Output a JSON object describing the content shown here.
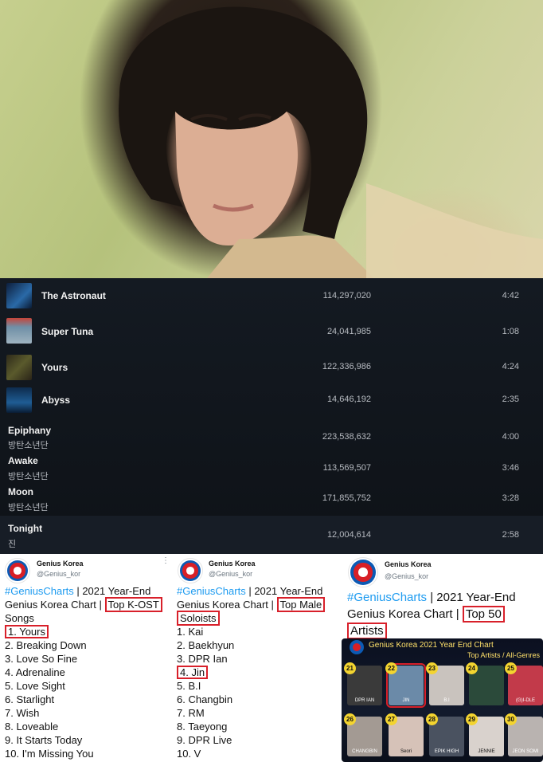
{
  "tracks": [
    {
      "title": "The Astronaut",
      "artist": "",
      "plays": "114,297,020",
      "duration": "4:42",
      "thumb": "#2a6aa8",
      "hasArt": true
    },
    {
      "title": "Super Tuna",
      "artist": "",
      "plays": "24,041,985",
      "duration": "1:08",
      "thumb": "#6f8fa6",
      "hasArt": true
    },
    {
      "title": "Yours",
      "artist": "",
      "plays": "122,336,986",
      "duration": "4:24",
      "thumb": "#4a4f2a",
      "hasArt": true
    },
    {
      "title": "Abyss",
      "artist": "",
      "plays": "14,646,192",
      "duration": "2:35",
      "thumb": "#1c4a7a",
      "hasArt": true
    },
    {
      "title": "Epiphany",
      "artist": "방탄소년단",
      "plays": "223,538,632",
      "duration": "4:00",
      "hasArt": false
    },
    {
      "title": "Awake",
      "artist": "방탄소년단",
      "plays": "113,569,507",
      "duration": "3:46",
      "hasArt": false
    },
    {
      "title": "Moon",
      "artist": "방탄소년단",
      "plays": "171,855,752",
      "duration": "3:28",
      "hasArt": false
    },
    {
      "title": "Tonight",
      "artist": "진",
      "plays": "12,004,614",
      "duration": "2:58",
      "hasArt": false
    }
  ],
  "tweets": [
    {
      "name": "Genius Korea",
      "handle": "@Genius_kor",
      "hashtag": "#GeniusCharts",
      "text_a": " | 2021 Year-End Genius Korea Chart | ",
      "boxed": "Top K-OST",
      "text_b": " Songs",
      "list": [
        "1. Yours",
        "2. Breaking Down",
        "3. Love So Fine",
        "4. Adrenaline",
        "5. Love Sight",
        "6. Starlight",
        "7. Wish",
        "8. Loveable",
        "9. It Starts Today",
        "10. I'm Missing You"
      ]
    },
    {
      "name": "Genius Korea",
      "handle": "@Genius_kor",
      "hashtag": "#GeniusCharts",
      "text_a": " | 2021 Year-End Genius Korea Chart | ",
      "boxed_a": "Top Male",
      "boxed_b": "Soloists",
      "list": [
        "1. Kai",
        "2. Baekhyun",
        "3. DPR Ian",
        "4. Jin",
        "5. B.I",
        "6. Changbin",
        "7. RM",
        "8. Taeyong",
        "9. DPR Live",
        "10. V"
      ]
    },
    {
      "name": "Genius Korea",
      "handle": "@Genius_kor",
      "hashtag": "#GeniusCharts",
      "text_a": " | 2021 Year-End Genius Korea Chart | ",
      "boxed_a": "Top 50",
      "boxed_b": "Artists",
      "chart_title": "Genius Korea 2021 Year End Chart",
      "chart_sub": "Top Artists / All-Genres",
      "artists": [
        {
          "rank": "21",
          "name": "DPR IAN",
          "color": "#3a3a3a"
        },
        {
          "rank": "22",
          "name": "JIN",
          "color": "#6b8aa8"
        },
        {
          "rank": "23",
          "name": "B.I",
          "color": "#c9c3be"
        },
        {
          "rank": "24",
          "name": "",
          "color": "#2b4a3a"
        },
        {
          "rank": "25",
          "name": "(G)I-DLE",
          "color": "#c23a4a"
        },
        {
          "rank": "26",
          "name": "CHANGBIN",
          "color": "#a39a93"
        },
        {
          "rank": "27",
          "name": "Seori",
          "color": "#d6c2b8"
        },
        {
          "rank": "28",
          "name": "EPIK HIGH",
          "color": "#4a5260"
        },
        {
          "rank": "29",
          "name": "JENNIE",
          "color": "#d9d2cd"
        },
        {
          "rank": "30",
          "name": "JEON SOMI",
          "color": "#b9b3b0"
        }
      ]
    }
  ]
}
